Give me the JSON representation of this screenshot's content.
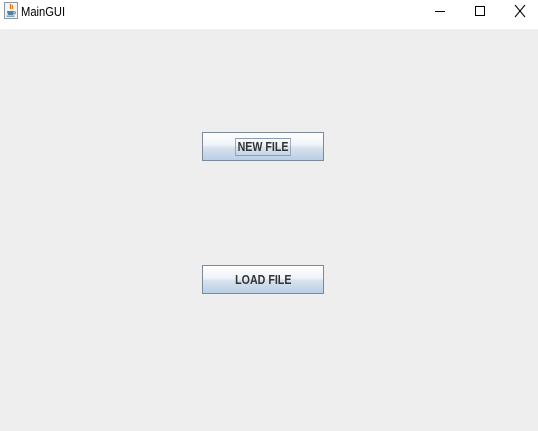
{
  "window": {
    "title": "MainGUI",
    "app_icon": "java-coffee-cup-icon",
    "controls": {
      "minimize": "minimize-icon",
      "maximize": "maximize-icon",
      "close": "close-icon"
    }
  },
  "main": {
    "new_file_label": "NEW FILE",
    "load_file_label": "LOAD FILE"
  },
  "colors": {
    "background": "#eeeeee",
    "titlebar": "#ffffff",
    "button_border": "#7a8a99",
    "button_text": "#333333"
  }
}
